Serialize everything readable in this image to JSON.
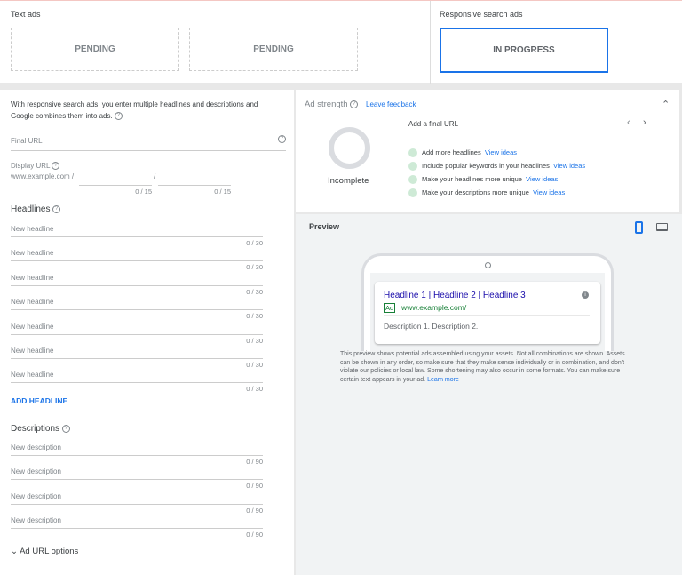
{
  "top": {
    "text_ads_label": "Text ads",
    "pending1": "PENDING",
    "pending2": "PENDING",
    "rsa_label": "Responsive search ads",
    "in_progress": "IN PROGRESS"
  },
  "form": {
    "intro": "With responsive search ads, you enter multiple headlines and descriptions and Google combines them into ads.",
    "final_url_placeholder": "Final URL",
    "display_url_label": "Display URL",
    "display_domain": "www.example.com /",
    "slash": "/",
    "path1_count": "0 / 15",
    "path2_count": "0 / 15",
    "headlines_title": "Headlines",
    "headlines": [
      {
        "ph": "New headline",
        "count": "0 / 30"
      },
      {
        "ph": "New headline",
        "count": "0 / 30"
      },
      {
        "ph": "New headline",
        "count": "0 / 30"
      },
      {
        "ph": "New headline",
        "count": "0 / 30"
      },
      {
        "ph": "New headline",
        "count": "0 / 30"
      },
      {
        "ph": "New headline",
        "count": "0 / 30"
      },
      {
        "ph": "New headline",
        "count": "0 / 30"
      }
    ],
    "add_headline": "ADD HEADLINE",
    "descriptions_title": "Descriptions",
    "descriptions": [
      {
        "ph": "New description",
        "count": "0 / 90"
      },
      {
        "ph": "New description",
        "count": "0 / 90"
      },
      {
        "ph": "New description",
        "count": "0 / 90"
      },
      {
        "ph": "New description",
        "count": "0 / 90"
      }
    ],
    "ad_url_options": "Ad URL options"
  },
  "strength": {
    "title": "Ad strength",
    "feedback": "Leave feedback",
    "status": "Incomplete",
    "current_tip": "Add a final URL",
    "tips": [
      {
        "text": "Add more headlines",
        "link": "View ideas"
      },
      {
        "text": "Include popular keywords in your headlines",
        "link": "View ideas"
      },
      {
        "text": "Make your headlines more unique",
        "link": "View ideas"
      },
      {
        "text": "Make your descriptions more unique",
        "link": "View ideas"
      }
    ]
  },
  "preview": {
    "title": "Preview",
    "headline": "Headline 1 | Headline 2 | Headline 3",
    "ad_badge": "Ad",
    "url": "www.example.com/",
    "description": "Description 1. Description 2.",
    "disclaimer": "This preview shows potential ads assembled using your assets. Not all combinations are shown. Assets can be shown in any order, so make sure that they make sense individually or in combination, and don't violate our policies or local law. Some shortening may also occur in some formats. You can make sure certain text appears in your ad.",
    "learn_more": "Learn more"
  }
}
